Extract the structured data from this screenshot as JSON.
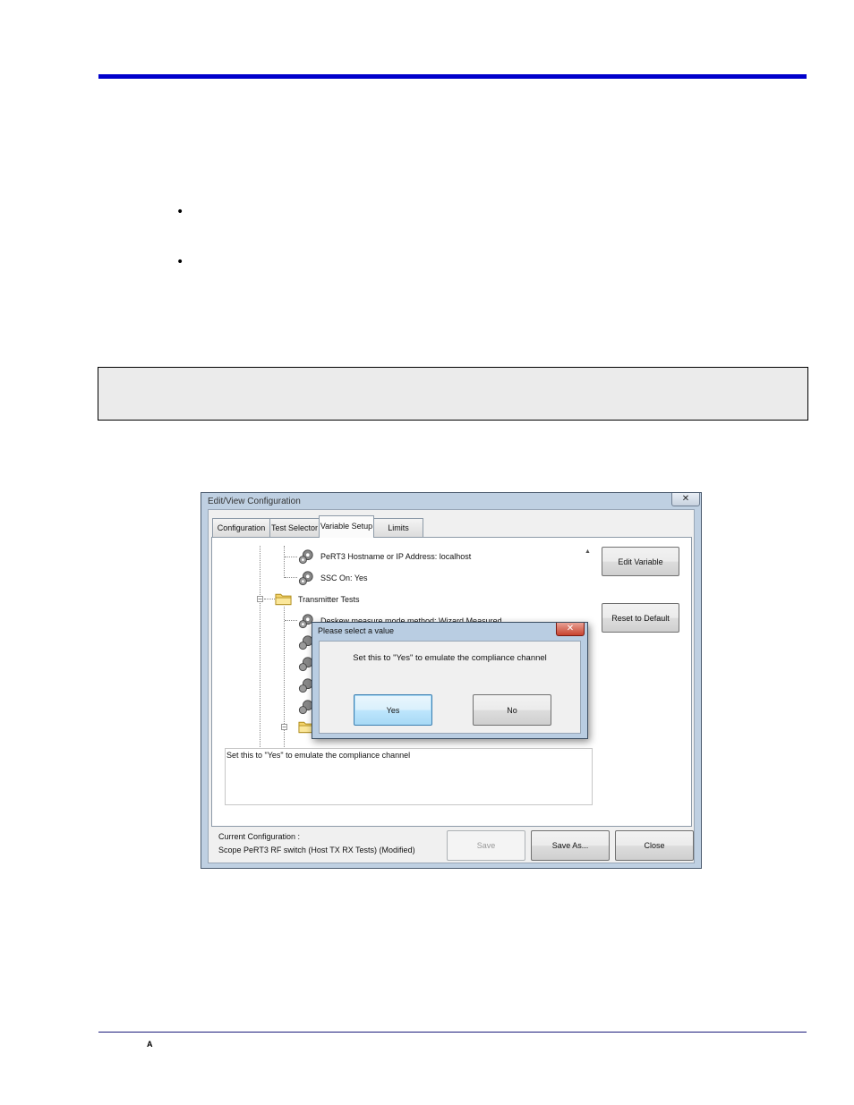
{
  "document": {
    "bullets": [
      "•",
      "•"
    ],
    "footer_glyph": "A"
  },
  "window": {
    "title": "Edit/View Configuration",
    "close_glyph": "✕",
    "tabs": [
      {
        "label": "Configuration"
      },
      {
        "label": "Test Selector"
      },
      {
        "label": "Variable Setup"
      },
      {
        "label": "Limits"
      }
    ],
    "tree": {
      "items": [
        {
          "label": "PeRT3 Hostname or IP Address: localhost"
        },
        {
          "label": "SSC On: Yes"
        },
        {
          "label": "Transmitter Tests"
        },
        {
          "label": "Deskew measure mode method: Wizard Measured"
        }
      ],
      "expander_glyph": "−",
      "scroll_up_glyph": "▲"
    },
    "description": "Set this to \"Yes\" to emulate the compliance channel",
    "side_buttons": {
      "edit_variable": "Edit Variable",
      "reset_to_default": "Reset to Default"
    },
    "status": {
      "label": "Current Configuration :",
      "value": "Scope PeRT3 RF switch (Host TX  RX Tests)  (Modified)"
    },
    "buttons": {
      "save": "Save",
      "save_as": "Save As...",
      "close": "Close"
    }
  },
  "dialog": {
    "title": "Please select a value",
    "close_glyph": "✕",
    "message": "Set this to \"Yes\" to emulate the compliance channel",
    "yes": "Yes",
    "no": "No"
  },
  "colors": {
    "top_rule": "#0000cc",
    "window_frame": "#bfd0e2",
    "dialog_close": "#c7432f",
    "focused_button": "#bee6fd"
  }
}
